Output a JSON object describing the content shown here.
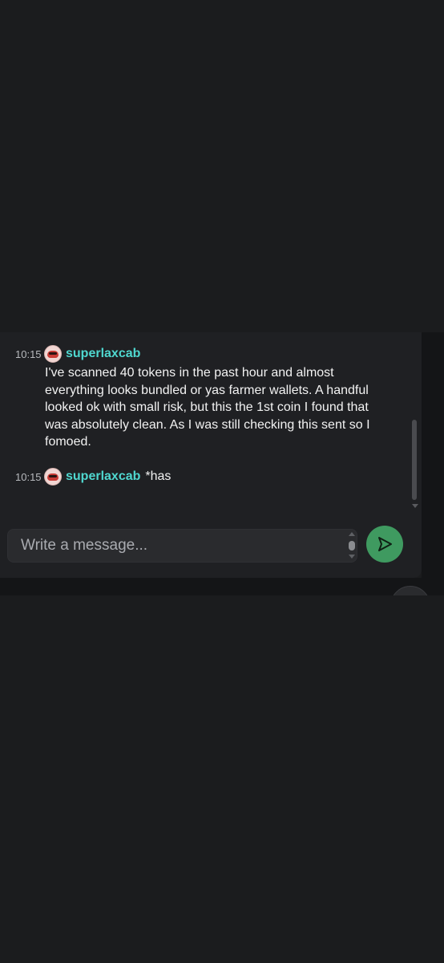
{
  "messages": [
    {
      "time": "10:15",
      "username": "superlaxcab",
      "text": "I've scanned 40 tokens in the past hour and almost everything looks bundled or yas farmer wallets. A handful looked ok with small risk, but this the 1st coin I found that was absolutely clean. As I was still checking this sent so I fomoed."
    },
    {
      "time": "10:15",
      "username": "superlaxcab",
      "text": "*has"
    }
  ],
  "composer": {
    "placeholder": "Write a message...",
    "value": ""
  },
  "icons": {
    "avatar": "avatar-icon",
    "send": "send-icon",
    "stepper": "chevron-up-down-icon",
    "corner": "send-icon"
  },
  "colors": {
    "username": "#4fd7cf",
    "send_button": "#3f9a60",
    "background": "#1b1c1e",
    "panel": "#1f2023"
  }
}
